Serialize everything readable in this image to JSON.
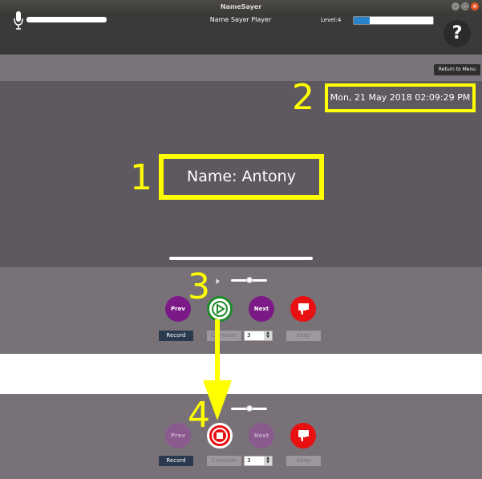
{
  "window": {
    "title": "NameSayer"
  },
  "header": {
    "app_title": "Name Sayer Player",
    "level_label": "Level:4",
    "level_progress": 0.2,
    "help_label": "?"
  },
  "menu": {
    "return_label": "Return to Menu"
  },
  "display": {
    "datetime": "Mon, 21 May 2018 02:09:29 PM",
    "name": "Name: Antony"
  },
  "annotations": {
    "one": "1",
    "two": "2",
    "three": "3",
    "four": "4"
  },
  "controls_top": {
    "prev_label": "Prev",
    "next_label": "Next",
    "record_label": "Record",
    "compare_label": "Compare",
    "compare_count": "3",
    "keep_label": "Keep"
  },
  "controls_bottom": {
    "prev_label": "Prev",
    "next_label": "Next",
    "record_label": "Record",
    "compare_label": "Compare",
    "compare_count": "3",
    "keep_label": "Keep"
  },
  "colors": {
    "annotation": "#ffff00",
    "play_ring": "#1f8a2b",
    "record_red": "#e81010",
    "nav_purple": "#7b1a86",
    "level_blue": "#2a82c8"
  },
  "icons": {
    "mic": "microphone-icon",
    "speaker": "speaker-icon",
    "play": "play-icon",
    "stop": "stop-icon",
    "dislike": "thumbs-down-icon"
  }
}
